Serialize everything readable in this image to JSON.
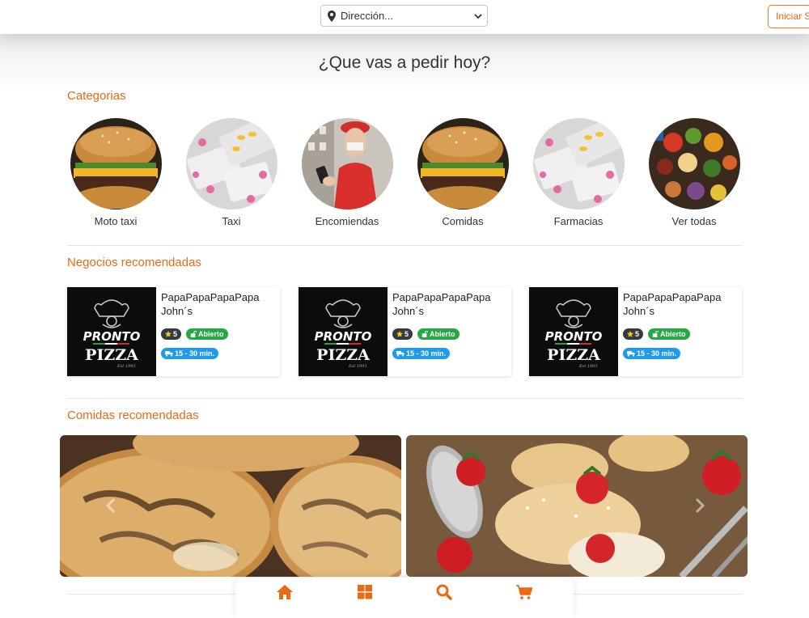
{
  "header": {
    "address_placeholder": "Dirección...",
    "login_label": "Iniciar S"
  },
  "headline": "¿Que vas a pedir hoy?",
  "categories": {
    "title": "Categorias",
    "items": [
      {
        "label": "Moto taxi",
        "image": "burger"
      },
      {
        "label": "Taxi",
        "image": "pills"
      },
      {
        "label": "Encomiendas",
        "image": "courier"
      },
      {
        "label": "Comidas",
        "image": "burger"
      },
      {
        "label": "Farmacias",
        "image": "pills"
      },
      {
        "label": "Ver todas",
        "image": "groceries"
      }
    ]
  },
  "businesses": {
    "title": "Negocios recomendadas",
    "items": [
      {
        "name": "PapaPapaPapaPapa John´s",
        "rating": "5",
        "status": "Abierto",
        "delivery_time": "15 - 30 min.",
        "logo_top": "PRONTO",
        "logo_bottom": "PIZZA",
        "logo_small": "Est 1993"
      },
      {
        "name": "PapaPapaPapaPapa John´s",
        "rating": "5",
        "status": "Abierto",
        "delivery_time": "15 - 30 min.",
        "logo_top": "PRONTO",
        "logo_bottom": "PIZZA",
        "logo_small": "Est 1993"
      },
      {
        "name": "PapaPapaPapaPapa John´s",
        "rating": "5",
        "status": "Abierto",
        "delivery_time": "15 - 30 min.",
        "logo_top": "PRONTO",
        "logo_bottom": "PIZZA",
        "logo_small": "Est 1993"
      }
    ]
  },
  "foods": {
    "title": "Comidas recomendadas",
    "items": [
      {
        "image": "arepas"
      },
      {
        "image": "strawberry-pastry"
      }
    ]
  },
  "bottom_nav": [
    {
      "icon": "home-icon"
    },
    {
      "icon": "grid-icon"
    },
    {
      "icon": "search-icon"
    },
    {
      "icon": "cart-icon"
    }
  ],
  "colors": {
    "accent": "#ea6a12",
    "open_badge": "#28a745",
    "time_badge": "#1e9bea",
    "rating_badge": "#343a40"
  }
}
